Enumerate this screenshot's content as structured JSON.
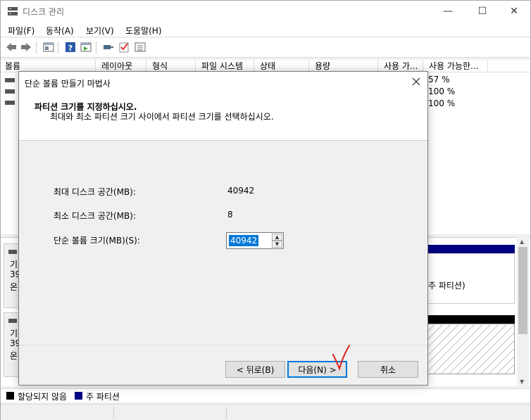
{
  "window": {
    "title": "디스크 관리",
    "controls": {
      "minimize": "—",
      "maximize": "☐",
      "close": "✕"
    }
  },
  "menu": [
    "파일(F)",
    "동작(A)",
    "보기(V)",
    "도움말(H)"
  ],
  "toolbar_icons": [
    "back-icon",
    "forward-icon",
    "properties-icon",
    "help-icon",
    "view-icon",
    "connect-icon",
    "check-icon",
    "list-icon"
  ],
  "columns": [
    "볼륨",
    "레이아웃",
    "형식",
    "파일 시스템",
    "상태",
    "용량",
    "사용 가...",
    "사용 가능한..."
  ],
  "volume_rows_visible_pct": [
    "57 %",
    "100 %",
    "100 %"
  ],
  "lower_pane": {
    "disk_labels": [
      "기",
      "39",
      "온",
      "기",
      "39",
      "온"
    ],
    "partition_text": "주 파티션)"
  },
  "legend": [
    {
      "label": "할당되지 않음",
      "color": "#000000"
    },
    {
      "label": "주 파티션",
      "color": "#000080"
    }
  ],
  "dialog": {
    "title": "단순 볼륨 만들기 마법사",
    "heading": "파티션 크기를 지정하십시오.",
    "subheading": "최대와 최소 파티션 크기 사이에서 파티션 크기를 선택하십시오.",
    "fields": {
      "max_label": "최대 디스크 공간(MB):",
      "max_value": "40942",
      "min_label": "최소 디스크 공간(MB):",
      "min_value": "8",
      "size_label": "단순 볼륨 크기(MB)(S):",
      "size_value": "40942"
    },
    "buttons": {
      "back": "< 뒤로(B)",
      "next": "다음(N) >",
      "cancel": "취소"
    }
  },
  "colors": {
    "accent": "#0078d7",
    "annotation": "#e0201b",
    "primary_partition": "#000080"
  }
}
